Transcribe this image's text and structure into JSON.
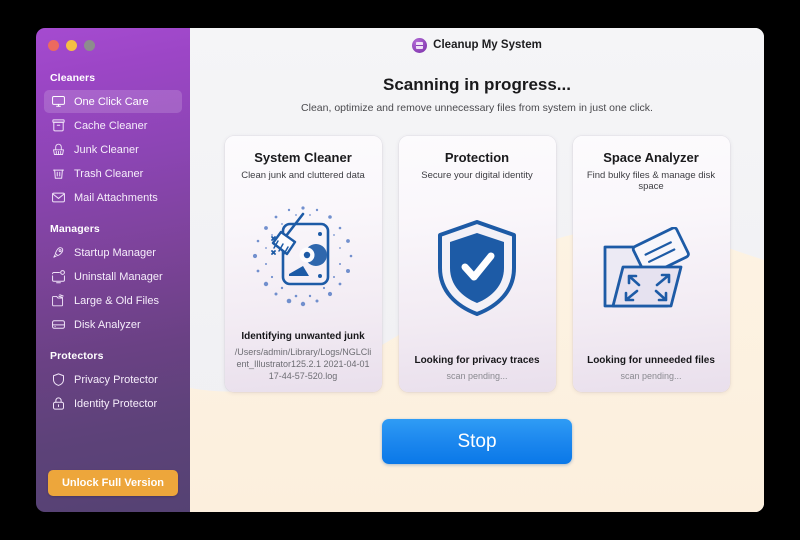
{
  "window": {
    "traffic_lights": [
      "close",
      "minimize",
      "zoom"
    ]
  },
  "titlebar": {
    "app_name": "Cleanup My System",
    "app_icon": "app-logo-icon"
  },
  "sidebar": {
    "sections": [
      {
        "header": "Cleaners",
        "items": [
          {
            "label": "One Click Care",
            "icon": "monitor-icon",
            "selected": true
          },
          {
            "label": "Cache Cleaner",
            "icon": "cache-box-icon",
            "selected": false
          },
          {
            "label": "Junk Cleaner",
            "icon": "broom-icon",
            "selected": false
          },
          {
            "label": "Trash Cleaner",
            "icon": "trash-icon",
            "selected": false
          },
          {
            "label": "Mail Attachments",
            "icon": "envelope-icon",
            "selected": false
          }
        ]
      },
      {
        "header": "Managers",
        "items": [
          {
            "label": "Startup Manager",
            "icon": "rocket-icon",
            "selected": false
          },
          {
            "label": "Uninstall Manager",
            "icon": "monitor-gear-icon",
            "selected": false
          },
          {
            "label": "Large & Old Files",
            "icon": "folder-files-icon",
            "selected": false
          },
          {
            "label": "Disk Analyzer",
            "icon": "disk-icon",
            "selected": false
          }
        ]
      },
      {
        "header": "Protectors",
        "items": [
          {
            "label": "Privacy Protector",
            "icon": "shield-icon",
            "selected": false
          },
          {
            "label": "Identity Protector",
            "icon": "lock-icon",
            "selected": false
          }
        ]
      }
    ],
    "unlock_button": "Unlock Full Version"
  },
  "main": {
    "headline": "Scanning in progress...",
    "subhead": "Clean, optimize and remove unnecessary files from system in just one click.",
    "cards": [
      {
        "title": "System Cleaner",
        "subtitle": "Clean junk and cluttered data",
        "art": "broom-sweeping-icon",
        "status": "Identifying unwanted junk",
        "detail": "/Users/admin/Library/Logs/NGLClient_Illustrator125.2.1 2021-04-01 17-44-57-520.log",
        "pending": false
      },
      {
        "title": "Protection",
        "subtitle": "Secure your digital identity",
        "art": "shield-check-icon",
        "status": "Looking for privacy traces",
        "detail": "scan pending...",
        "pending": true
      },
      {
        "title": "Space Analyzer",
        "subtitle": "Find bulky files & manage disk space",
        "art": "folder-expand-icon",
        "status": "Looking for unneeded files",
        "detail": "scan pending...",
        "pending": true
      }
    ],
    "stop_button": "Stop"
  },
  "colors": {
    "sidebar_top": "#a54bd0",
    "sidebar_bottom": "#554273",
    "accent_blue": "#1c87ee",
    "unlock_orange": "#eda63b",
    "art_blue": "#1d5ba6",
    "bg_top": "#f4f4f6",
    "bg_bottom": "#fdf1de"
  }
}
